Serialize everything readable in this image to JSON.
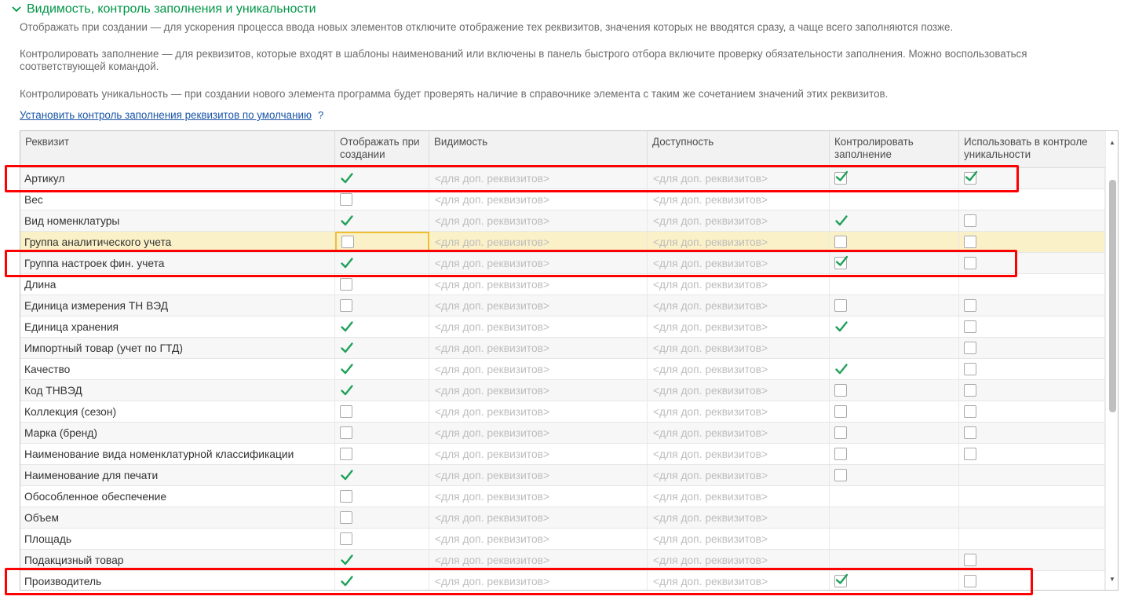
{
  "section": {
    "title": "Видимость, контроль заполнения и уникальности",
    "chevron_icon": "chevron-down-icon"
  },
  "descriptions": {
    "show_on_create": "Отображать при создании — для ускорения процесса ввода новых элементов отключите отображение тех реквизитов, значения которых не вводятся сразу, а чаще всего заполняются позже.",
    "control_fill": "Контролировать заполнение — для реквизитов, которые входят в шаблоны наименований или включены в панель быстрого отбора включите проверку обязательности заполнения. Можно воспользоваться соответствующей командой.",
    "control_unique": "Контролировать уникальность — при создании нового элемента программа будет проверять наличие в справочнике элемента с таким же сочетанием значений этих реквизитов."
  },
  "default_link": {
    "label": "Установить контроль заполнения реквизитов по умолчанию",
    "help": "?"
  },
  "table": {
    "columns": {
      "attribute": "Реквизит",
      "show_on_create": "Отображать при создании",
      "visibility": "Видимость",
      "availability": "Доступность",
      "control_fill": "Контролировать заполнение",
      "uniqueness": "Использовать в контроле уникальности"
    },
    "placeholder": "<для доп. реквизитов>",
    "rows": [
      {
        "name": "Артикул",
        "show": "check",
        "fill": "box-checked",
        "unique": "box-checked",
        "highlight": true
      },
      {
        "name": "Вес",
        "show": "box",
        "fill": "none",
        "unique": "none"
      },
      {
        "name": "Вид номенклатуры",
        "show": "check",
        "fill": "check",
        "unique": "box"
      },
      {
        "name": "Группа аналитического учета",
        "show": "box",
        "fill": "box",
        "unique": "box",
        "selected": true
      },
      {
        "name": "Группа настроек фин. учета",
        "show": "check",
        "fill": "box-checked",
        "unique": "box",
        "highlight": true
      },
      {
        "name": "Длина",
        "show": "box",
        "fill": "none",
        "unique": "none"
      },
      {
        "name": "Единица измерения ТН ВЭД",
        "show": "box",
        "fill": "box",
        "unique": "box"
      },
      {
        "name": "Единица хранения",
        "show": "check",
        "fill": "check",
        "unique": "box"
      },
      {
        "name": "Импортный товар (учет по ГТД)",
        "show": "check",
        "fill": "none",
        "unique": "box"
      },
      {
        "name": "Качество",
        "show": "check",
        "fill": "check",
        "unique": "box"
      },
      {
        "name": "Код ТНВЭД",
        "show": "check",
        "fill": "box",
        "unique": "box"
      },
      {
        "name": "Коллекция (сезон)",
        "show": "box",
        "fill": "box",
        "unique": "box"
      },
      {
        "name": "Марка (бренд)",
        "show": "box",
        "fill": "box",
        "unique": "box"
      },
      {
        "name": "Наименование вида номенклатурной классификации",
        "show": "box",
        "fill": "box",
        "unique": "box"
      },
      {
        "name": "Наименование для печати",
        "show": "check",
        "fill": "box",
        "unique": "none"
      },
      {
        "name": "Обособленное обеспечение",
        "show": "box",
        "fill": "none",
        "unique": "none"
      },
      {
        "name": "Объем",
        "show": "box",
        "fill": "none",
        "unique": "none"
      },
      {
        "name": "Площадь",
        "show": "box",
        "fill": "none",
        "unique": "none"
      },
      {
        "name": "Подакцизный товар",
        "show": "check",
        "fill": "none",
        "unique": "box"
      },
      {
        "name": "Производитель",
        "show": "check",
        "fill": "box-checked",
        "unique": "box",
        "highlight": true
      }
    ]
  },
  "colors": {
    "accent_green": "#009646",
    "link_blue": "#1a55a7",
    "highlight_red": "#ff0000",
    "selected_row": "#fbf1c8",
    "focus_border": "#f0c033"
  },
  "icons": {
    "check": "green-check-icon",
    "checkbox": "checkbox-icon",
    "scroll_up": "scroll-up-icon",
    "scroll_down": "scroll-down-icon"
  }
}
